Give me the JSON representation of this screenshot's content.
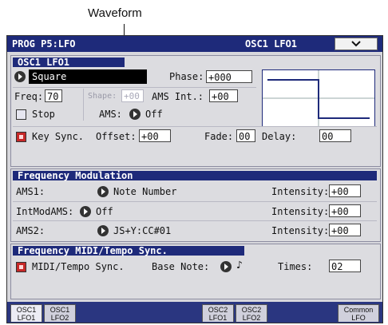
{
  "callout": "Waveform",
  "title": {
    "left": "PROG P5:LFO",
    "right": "OSC1 LFO1"
  },
  "menu_icon": "chevron-down-icon",
  "osc1": {
    "header": "OSC1 LFO1",
    "waveform": "Square",
    "phase_label": "Phase:",
    "phase_value": "+000",
    "freq_label": "Freq:",
    "freq_value": "70",
    "shape_label": "Shape:",
    "shape_value": "+00",
    "ams_int_label": "AMS Int.:",
    "ams_int_value": "+00",
    "stop_label": "Stop",
    "ams_label": "AMS:",
    "ams_value": "Off",
    "keysync_label": "Key Sync.",
    "offset_label": "Offset:",
    "offset_value": "+00",
    "fade_label": "Fade:",
    "fade_value": "00",
    "delay_label": "Delay:",
    "delay_value": "00"
  },
  "freqmod": {
    "header": "Frequency Modulation",
    "rows": [
      {
        "label": "AMS1:",
        "source": "Note Number",
        "intensity_label": "Intensity:",
        "intensity": "+00"
      },
      {
        "label": "IntModAMS:",
        "source": "Off",
        "intensity_label": "Intensity:",
        "intensity": "+00"
      },
      {
        "label": "AMS2:",
        "source": "JS+Y:CC#01",
        "intensity_label": "Intensity:",
        "intensity": "+00"
      }
    ]
  },
  "midisync": {
    "header": "Frequency MIDI/Tempo Sync.",
    "sync_label": "MIDI/Tempo Sync.",
    "base_note_label": "Base Note:",
    "base_note_value": "♪",
    "times_label": "Times:",
    "times_value": "02"
  },
  "tabs": [
    {
      "l1": "OSC1",
      "l2": "LFO1"
    },
    {
      "l1": "OSC1",
      "l2": "LFO2"
    },
    {
      "l1": "OSC2",
      "l2": "LFO1"
    },
    {
      "l1": "OSC2",
      "l2": "LFO2"
    },
    {
      "l1": "Common",
      "l2": "LFO"
    }
  ],
  "colors": {
    "header_bg": "#1e2a7a",
    "checkbox_on": "#c62828",
    "screen_bg": "#d7d7dc"
  }
}
